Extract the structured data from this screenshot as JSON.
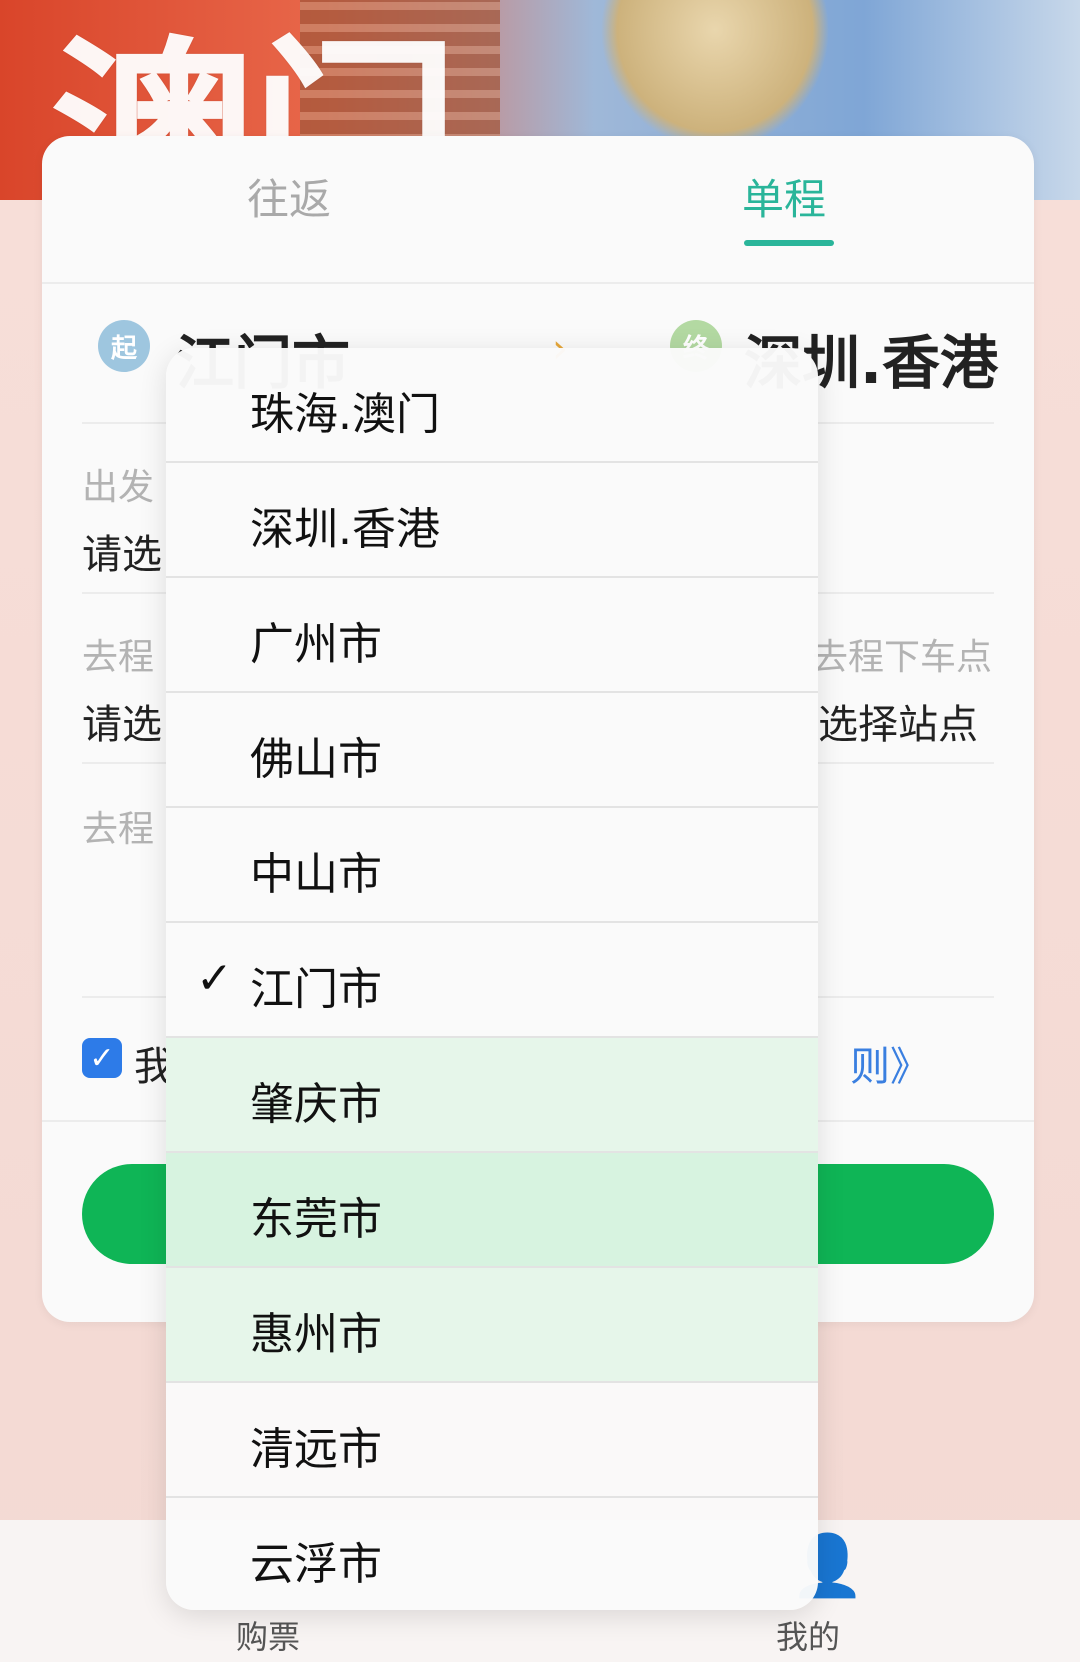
{
  "banner": {
    "title": "澳门"
  },
  "tabs": [
    {
      "label": "往返",
      "active": false
    },
    {
      "label": "单程",
      "active": true
    }
  ],
  "route": {
    "from_badge": "起",
    "from_city": "江门市",
    "to_badge": "终",
    "to_city": "深圳.香港"
  },
  "fields": {
    "departure_label": "出发",
    "departure_value": "请选",
    "pickup_label": "去程",
    "pickup_value": "请选",
    "dropoff_label": "去程下车点",
    "dropoff_value": "选择站点",
    "time_label": "去程"
  },
  "agreement": {
    "checked": true,
    "text": "我",
    "rules_link": "则》"
  },
  "bottom_nav": {
    "buy_label": "购票",
    "mine_label": "我的"
  },
  "dropdown": {
    "selected": "江门市",
    "check_mark": "✓",
    "options": [
      "珠海.澳门",
      "深圳.香港",
      "广州市",
      "佛山市",
      "中山市",
      "江门市",
      "肇庆市",
      "东莞市",
      "惠州市",
      "清远市",
      "云浮市"
    ]
  },
  "colors": {
    "accent": "#2ab59a",
    "primary_button": "#0fb556",
    "link": "#3a7fe0",
    "checkbox": "#2d7be8"
  }
}
